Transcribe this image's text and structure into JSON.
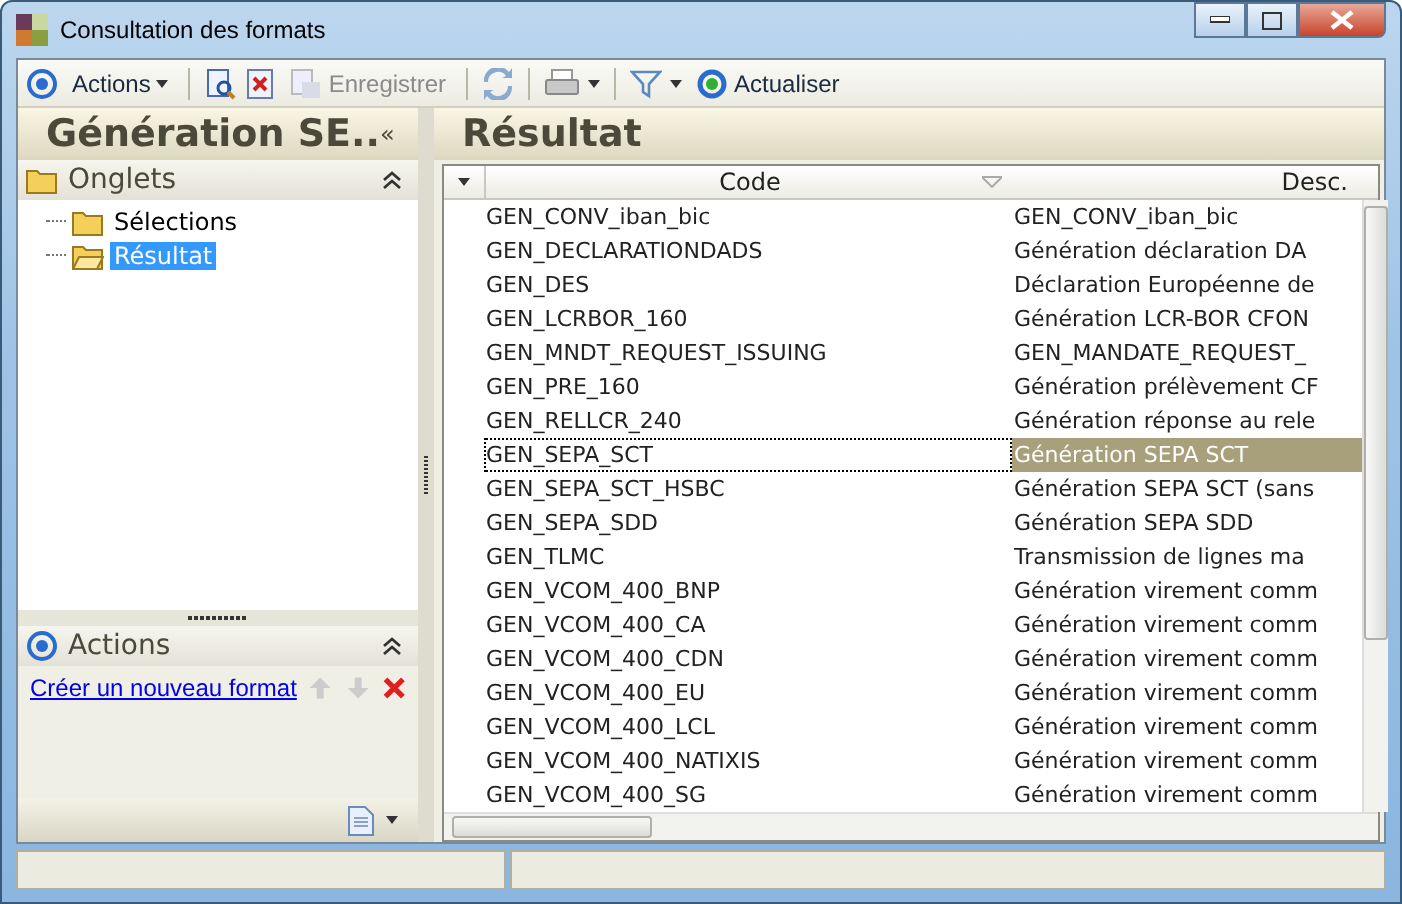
{
  "window": {
    "title": "Consultation des formats"
  },
  "toolbar": {
    "actions": {
      "label": "Actions"
    },
    "save": {
      "label": "Enregistrer",
      "disabled": true
    },
    "refresh": {
      "label": "Actualiser",
      "disabled": false
    }
  },
  "left_panel": {
    "title": "Génération SE..",
    "collapse_glyph": "«",
    "tabs_section": {
      "title": "Onglets",
      "items": [
        {
          "label": "Sélections",
          "selected": false
        },
        {
          "label": "Résultat",
          "selected": true
        }
      ]
    },
    "actions_section": {
      "title": "Actions",
      "link": "Créer un nouveau format"
    }
  },
  "result": {
    "title": "Résultat",
    "columns": [
      "Code",
      "Desc."
    ],
    "rows": [
      {
        "code": "GEN_CONV_iban_bic",
        "desc": "GEN_CONV_iban_bic",
        "selected": false
      },
      {
        "code": "GEN_DECLARATIONDADS",
        "desc": "Génération déclaration DA",
        "selected": false
      },
      {
        "code": "GEN_DES",
        "desc": "Déclaration Européenne de",
        "selected": false
      },
      {
        "code": "GEN_LCRBOR_160",
        "desc": "Génération LCR-BOR CFON",
        "selected": false
      },
      {
        "code": "GEN_MNDT_REQUEST_ISSUING",
        "desc": "GEN_MANDATE_REQUEST_",
        "selected": false
      },
      {
        "code": "GEN_PRE_160",
        "desc": "Génération prélèvement CF",
        "selected": false
      },
      {
        "code": "GEN_RELLCR_240",
        "desc": "Génération réponse au rele",
        "selected": false
      },
      {
        "code": "GEN_SEPA_SCT",
        "desc": "Génération SEPA SCT",
        "selected": true
      },
      {
        "code": "GEN_SEPA_SCT_HSBC",
        "desc": "Génération SEPA SCT (sans",
        "selected": false
      },
      {
        "code": "GEN_SEPA_SDD",
        "desc": "Génération SEPA SDD",
        "selected": false
      },
      {
        "code": "GEN_TLMC",
        "desc": "Transmission de lignes ma",
        "selected": false
      },
      {
        "code": "GEN_VCOM_400_BNP",
        "desc": "Génération virement comm",
        "selected": false
      },
      {
        "code": "GEN_VCOM_400_CA",
        "desc": "Génération virement comm",
        "selected": false
      },
      {
        "code": "GEN_VCOM_400_CDN",
        "desc": "Génération virement comm",
        "selected": false
      },
      {
        "code": "GEN_VCOM_400_EU",
        "desc": "Génération virement comm",
        "selected": false
      },
      {
        "code": "GEN_VCOM_400_LCL",
        "desc": "Génération virement comm",
        "selected": false
      },
      {
        "code": "GEN_VCOM_400_NATIXIS",
        "desc": "Génération virement comm",
        "selected": false
      },
      {
        "code": "GEN_VCOM_400_SG",
        "desc": "Génération virement comm",
        "selected": false
      }
    ]
  }
}
